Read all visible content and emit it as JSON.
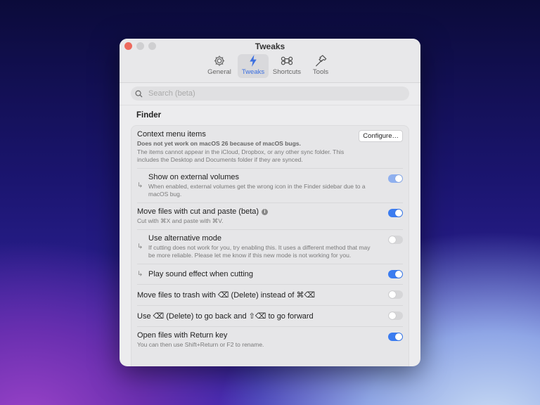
{
  "window": {
    "title": "Tweaks"
  },
  "tabs": [
    {
      "label": "General",
      "icon": "gear-icon"
    },
    {
      "label": "Tweaks",
      "icon": "bolt-icon"
    },
    {
      "label": "Shortcuts",
      "icon": "command-icon"
    },
    {
      "label": "Tools",
      "icon": "hammer-icon"
    }
  ],
  "search": {
    "placeholder": "Search (beta)"
  },
  "section": "Finder",
  "rows": [
    {
      "title": "Context menu items",
      "bold": "Does not yet work on macOS 26 because of macOS bugs.",
      "desc": "The items cannot appear in the iCloud, Dropbox, or any other sync folder. This includes the Desktop and Documents folder if they are synced.",
      "button": "Configure…"
    },
    {
      "title": "Show on external volumes",
      "desc": "When enabled, external volumes get the wrong icon in the Finder sidebar due to a macOS bug.",
      "on": true,
      "disabled": true
    },
    {
      "title": "Move files with cut and paste (beta)",
      "desc": "Cut with ⌘X and paste with ⌘V.",
      "on": true,
      "info": "i"
    },
    {
      "title": "Use alternative mode",
      "desc": "If cutting does not work for you, try enabling this. It uses a different method that may be more reliable. Please let me know if this new mode is not working for you.",
      "on": false
    },
    {
      "title": "Play sound effect when cutting",
      "on": true
    },
    {
      "title": "Move files to trash with ⌫ (Delete) instead of ⌘⌫",
      "on": false
    },
    {
      "title": "Use ⌫ (Delete) to go back and ⇧⌫ to go forward",
      "on": false
    },
    {
      "title": "Open files with Return key",
      "desc": "You can then use Shift+Return or F2 to rename.",
      "on": true
    }
  ],
  "sub_arrow": "↳"
}
